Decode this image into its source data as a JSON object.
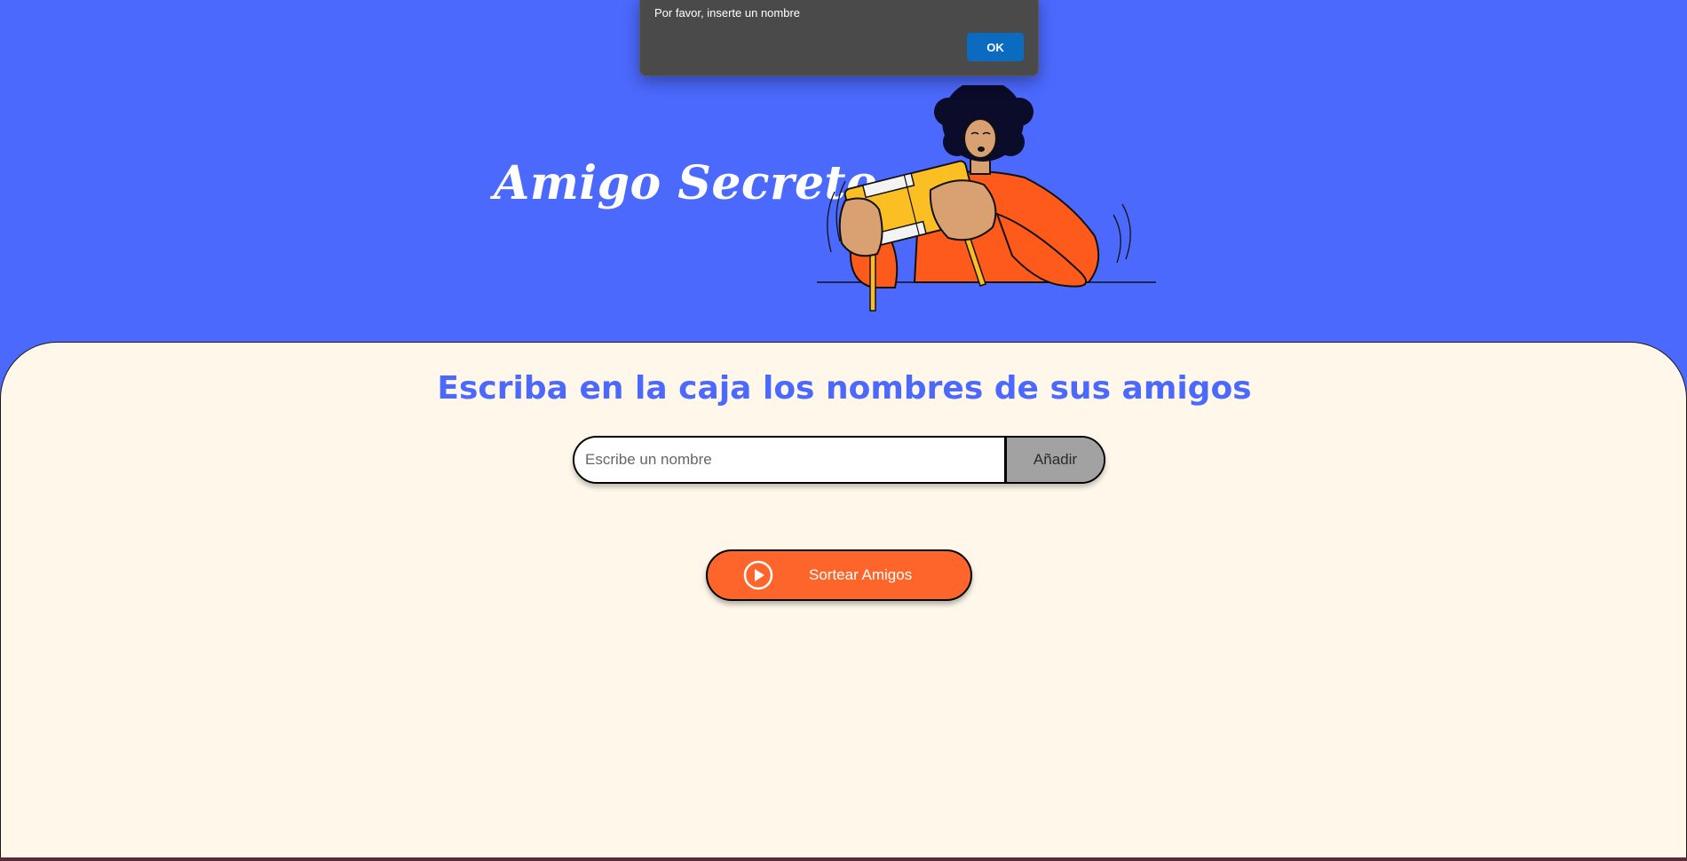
{
  "header": {
    "title": "Amigo Secreto"
  },
  "main": {
    "title": "Escriba en la caja los nombres de sus amigos",
    "input": {
      "placeholder": "Escribe un nombre",
      "value": ""
    },
    "add_label": "Añadir",
    "draw_label": "Sortear Amigos"
  },
  "alert": {
    "message": "Por favor, inserte un nombre",
    "ok_label": "OK"
  },
  "colors": {
    "header_bg": "#4b69fd",
    "main_bg": "#fff8ea",
    "accent_blue": "#4b69fd",
    "draw_button": "#fe652b",
    "add_button": "#a2a2a2",
    "dialog_bg": "#4a4a4a",
    "dialog_ok": "#0a6bc0"
  },
  "icons": {
    "draw": "play-circle-icon",
    "illustration": "person-holding-gift-illustration"
  }
}
